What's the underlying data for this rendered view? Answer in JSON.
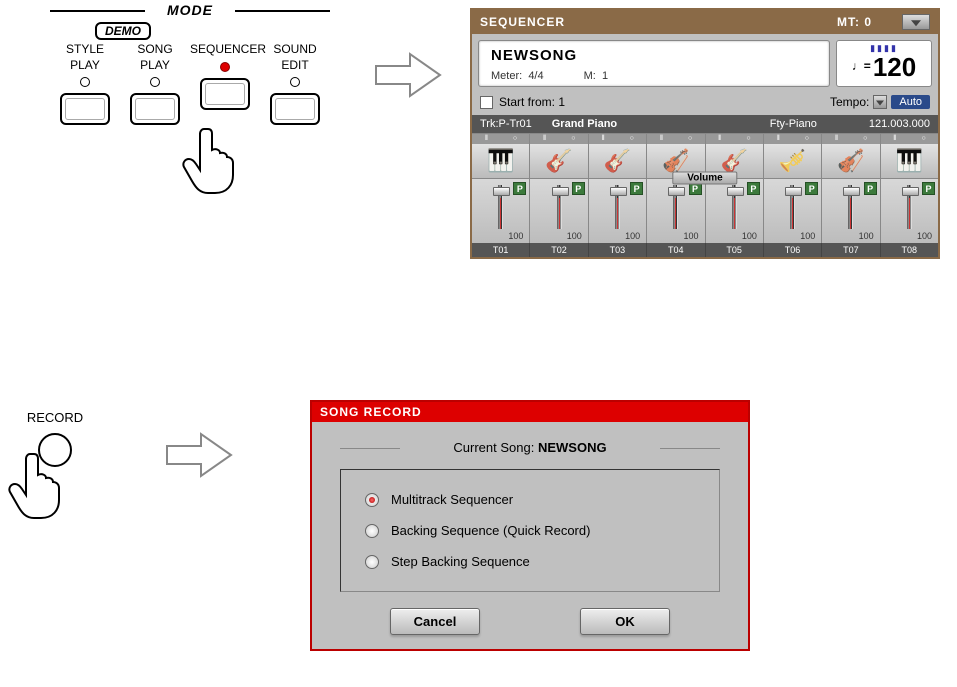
{
  "mode": {
    "title": "MODE",
    "demo": "DEMO",
    "items": [
      {
        "line1": "STYLE",
        "line2": "PLAY",
        "on": false
      },
      {
        "line1": "SONG",
        "line2": "PLAY",
        "on": false
      },
      {
        "line1": "SEQUENCER",
        "line2": "",
        "on": true
      },
      {
        "line1": "SOUND",
        "line2": "EDIT",
        "on": false
      }
    ]
  },
  "sequencer": {
    "title": "SEQUENCER",
    "mt": "MT: 0",
    "song_name": "NEWSONG",
    "meter_label": "Meter:",
    "meter_value": "4/4",
    "measure_label": "M:",
    "measure_value": "1",
    "tempo_beats": "▮▮▮▮",
    "tempo_note": "♩=",
    "tempo_value": "120",
    "start_from_label": "Start from:",
    "start_from_value": "1",
    "tempo_label": "Tempo:",
    "tempo_mode": "Auto",
    "track_info": {
      "trk": "Trk:P-Tr01",
      "name": "Grand Piano",
      "family": "Fty-Piano",
      "program": "121.003.000"
    },
    "volume_label": "Volume",
    "instruments": [
      "🎹",
      "🎸",
      "🎸",
      "🎻",
      "🎸",
      "🎺",
      "🎻",
      "🎹"
    ],
    "faders": [
      {
        "badge": "P",
        "value": "100",
        "label": "T01"
      },
      {
        "badge": "P",
        "value": "100",
        "label": "T02"
      },
      {
        "badge": "P",
        "value": "100",
        "label": "T03"
      },
      {
        "badge": "P",
        "value": "100",
        "label": "T04"
      },
      {
        "badge": "P",
        "value": "100",
        "label": "T05"
      },
      {
        "badge": "P",
        "value": "100",
        "label": "T06"
      },
      {
        "badge": "P",
        "value": "100",
        "label": "T07"
      },
      {
        "badge": "P",
        "value": "100",
        "label": "T08"
      }
    ]
  },
  "record": {
    "label": "RECORD"
  },
  "song_record": {
    "title": "SONG RECORD",
    "current_label": "Current Song:",
    "current_value": "NEWSONG",
    "options": [
      {
        "label": "Multitrack Sequencer",
        "selected": true
      },
      {
        "label": "Backing Sequence (Quick Record)",
        "selected": false
      },
      {
        "label": "Step Backing Sequence",
        "selected": false
      }
    ],
    "cancel": "Cancel",
    "ok": "OK"
  }
}
